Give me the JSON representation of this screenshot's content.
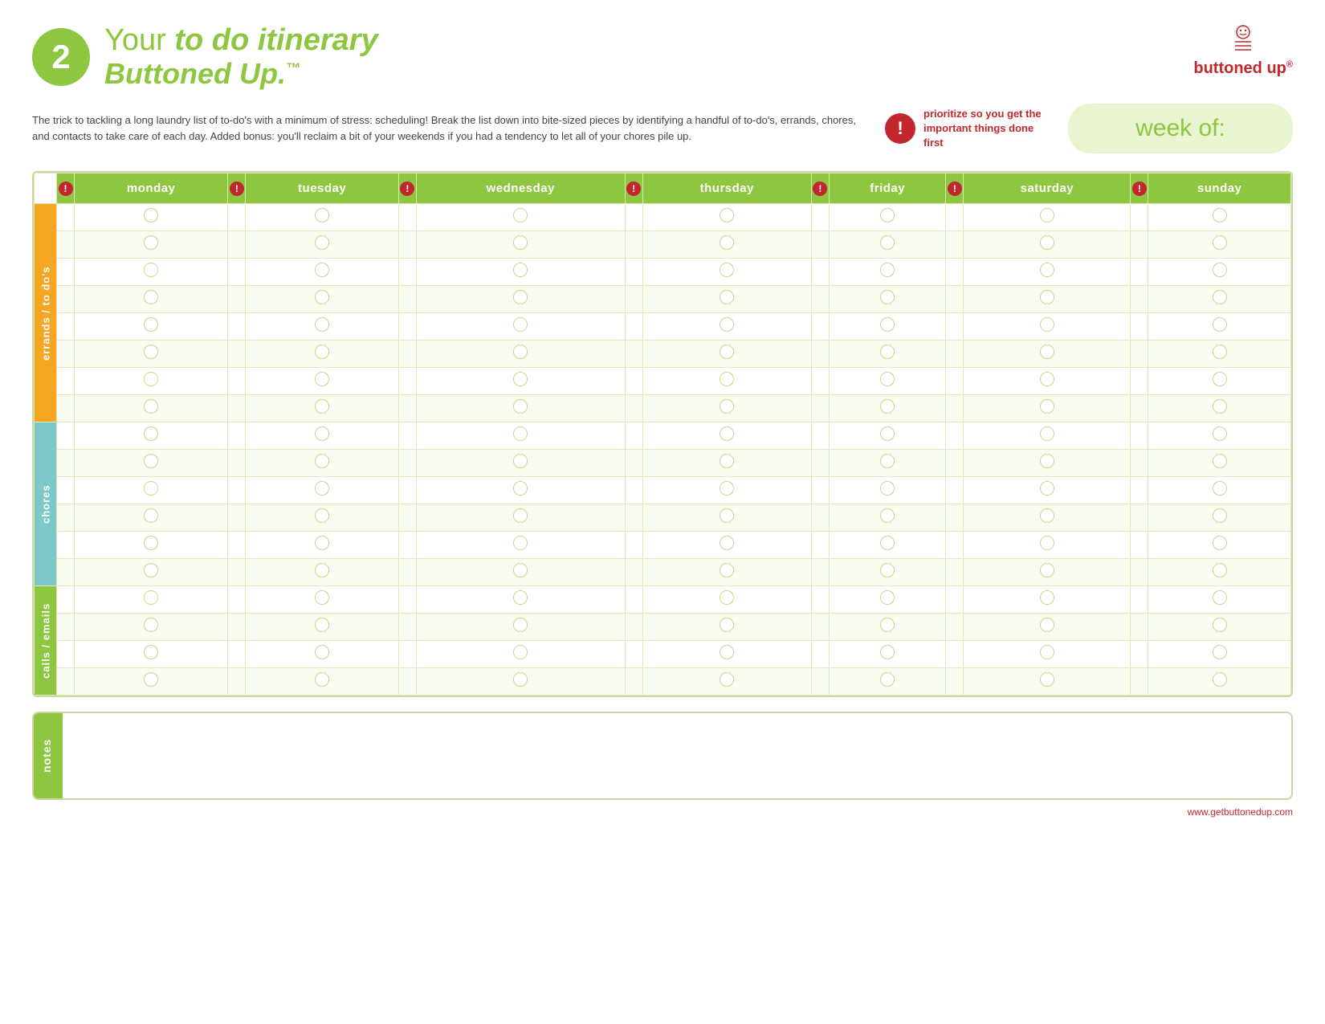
{
  "header": {
    "number": "2",
    "title_normal": "Your ",
    "title_bold": "to do itinerary",
    "title_line2": "Buttoned Up.",
    "title_tm": "™"
  },
  "logo": {
    "text": "buttoned up",
    "sup": "®"
  },
  "intro": {
    "body": "The trick to tackling a long laundry list of to-do's with a minimum of stress: scheduling! Break the list down into bite-sized pieces by identifying a handful of to-do's, errands, chores, and contacts to take care of each day. Added bonus: you'll reclaim a bit of your weekends if you had a tendency to let all of your chores pile up."
  },
  "priority": {
    "text": "prioritize so you get the important things done first"
  },
  "week_of": {
    "label": "week of:"
  },
  "days": [
    "monday",
    "tuesday",
    "wednesday",
    "thursday",
    "friday",
    "saturday",
    "sunday"
  ],
  "sections": [
    {
      "id": "errands",
      "label": "errands / to do's",
      "rows": 8,
      "color": "errands"
    },
    {
      "id": "chores",
      "label": "chores",
      "rows": 6,
      "color": "chores"
    },
    {
      "id": "calls",
      "label": "calls / emails",
      "rows": 4,
      "color": "calls"
    }
  ],
  "notes": {
    "label": "notes"
  },
  "footer": {
    "url": "www.getbuttonedup.com"
  }
}
